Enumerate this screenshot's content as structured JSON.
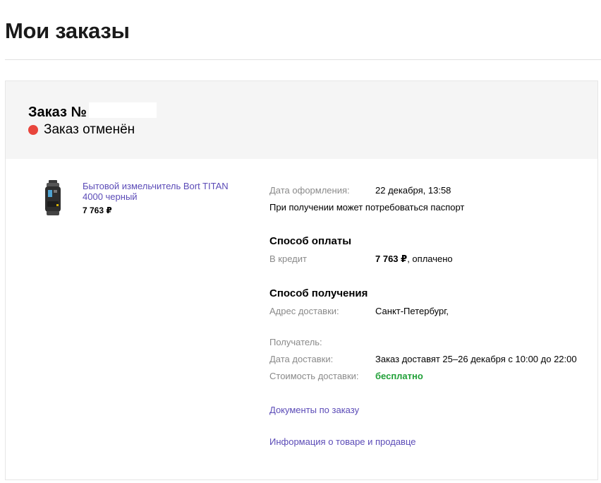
{
  "page": {
    "title": "Мои заказы"
  },
  "order": {
    "number_label": "Заказ №",
    "status": "Заказ отменён",
    "status_color": "#e8453c",
    "product": {
      "name": "Бытовой измельчитель Bort TITAN 4000 черный",
      "price": "7 763 ₽",
      "image_icon": "food-waste-disposer-image"
    },
    "details": {
      "date_label": "Дата оформления:",
      "date_value": "22 декабря, 13:58",
      "passport_note": "При получении может потребоваться паспорт",
      "payment_title": "Способ оплаты",
      "payment_label": "В кредит",
      "payment_amount": "7 763 ₽",
      "payment_status": ", оплачено",
      "delivery_title": "Способ получения",
      "address_label": "Адрес доставки:",
      "address_value": "Санкт-Петербург,",
      "recipient_label": "Получатель:",
      "delivery_date_label": "Дата доставки:",
      "delivery_date_value": "Заказ доставят 25–26 декабря с 10:00 до 22:00",
      "delivery_cost_label": "Стоимость доставки:",
      "delivery_cost_value": "бесплатно"
    },
    "links": {
      "documents": "Документы по заказу",
      "product_info": "Информация о товаре и продавце"
    }
  }
}
